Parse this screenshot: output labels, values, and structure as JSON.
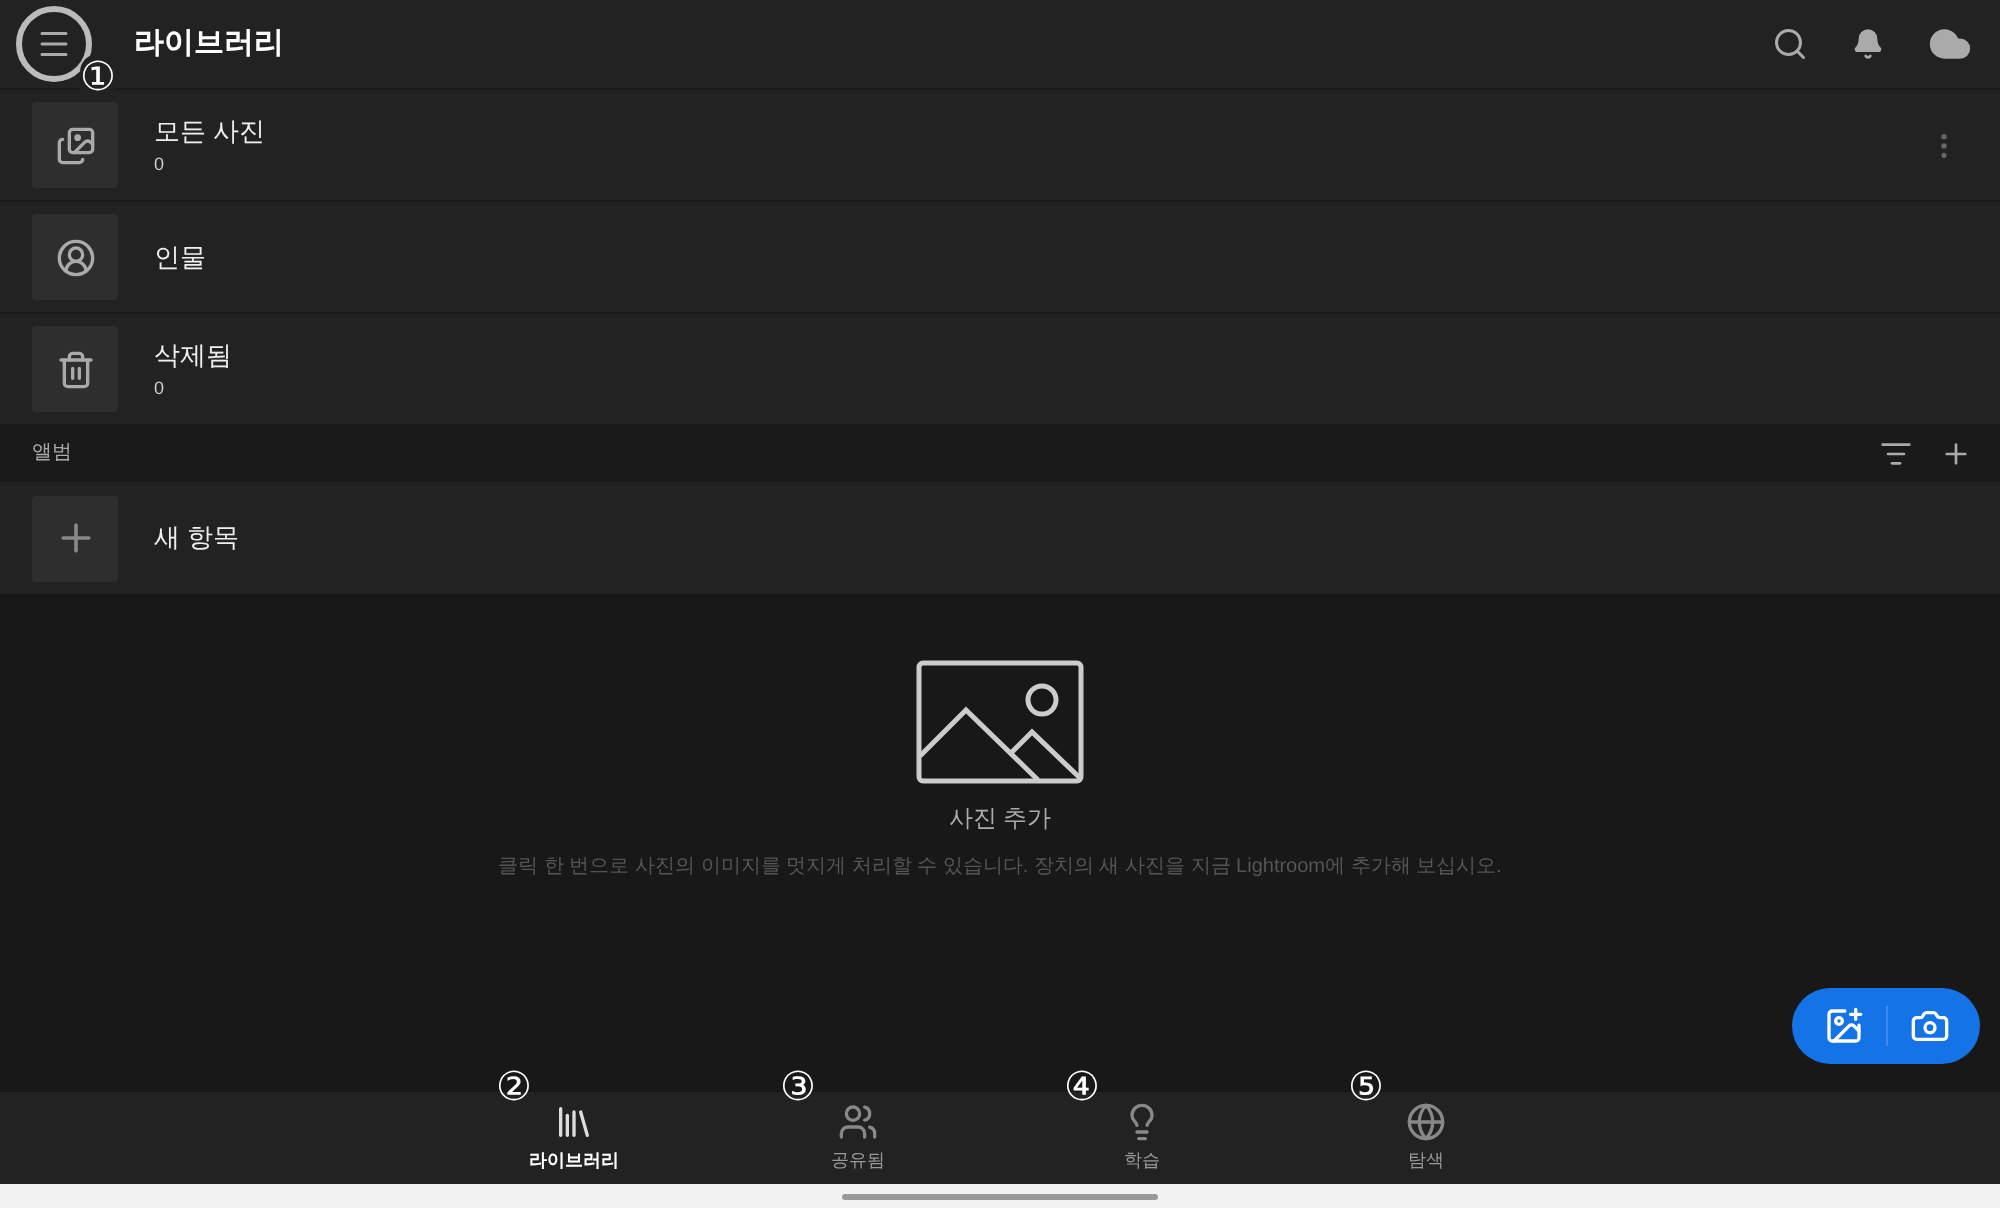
{
  "header": {
    "title": "라이브러리",
    "annotation": "①"
  },
  "library_items": [
    {
      "kind": "photos",
      "title": "모든 사진",
      "count": "0",
      "more": true
    },
    {
      "kind": "people",
      "title": "인물"
    },
    {
      "kind": "trash",
      "title": "삭제됨",
      "count": "0"
    }
  ],
  "albums": {
    "label": "앨범",
    "new_item": "새 항목"
  },
  "empty_state": {
    "title": "사진 추가",
    "message": "클릭 한 번으로 사진의 이미지를 멋지게 처리할 수 있습니다. 장치의 새 사진을 지금 Lightroom에 추가해 보십시오."
  },
  "bottom_nav": [
    {
      "kind": "library",
      "label": "라이브러리",
      "selected": true,
      "annotation": "②"
    },
    {
      "kind": "shared",
      "label": "공유됨",
      "selected": false,
      "annotation": "③"
    },
    {
      "kind": "learn",
      "label": "학습",
      "selected": false,
      "annotation": "④"
    },
    {
      "kind": "discover",
      "label": "탐색",
      "selected": false,
      "annotation": "⑤"
    }
  ]
}
